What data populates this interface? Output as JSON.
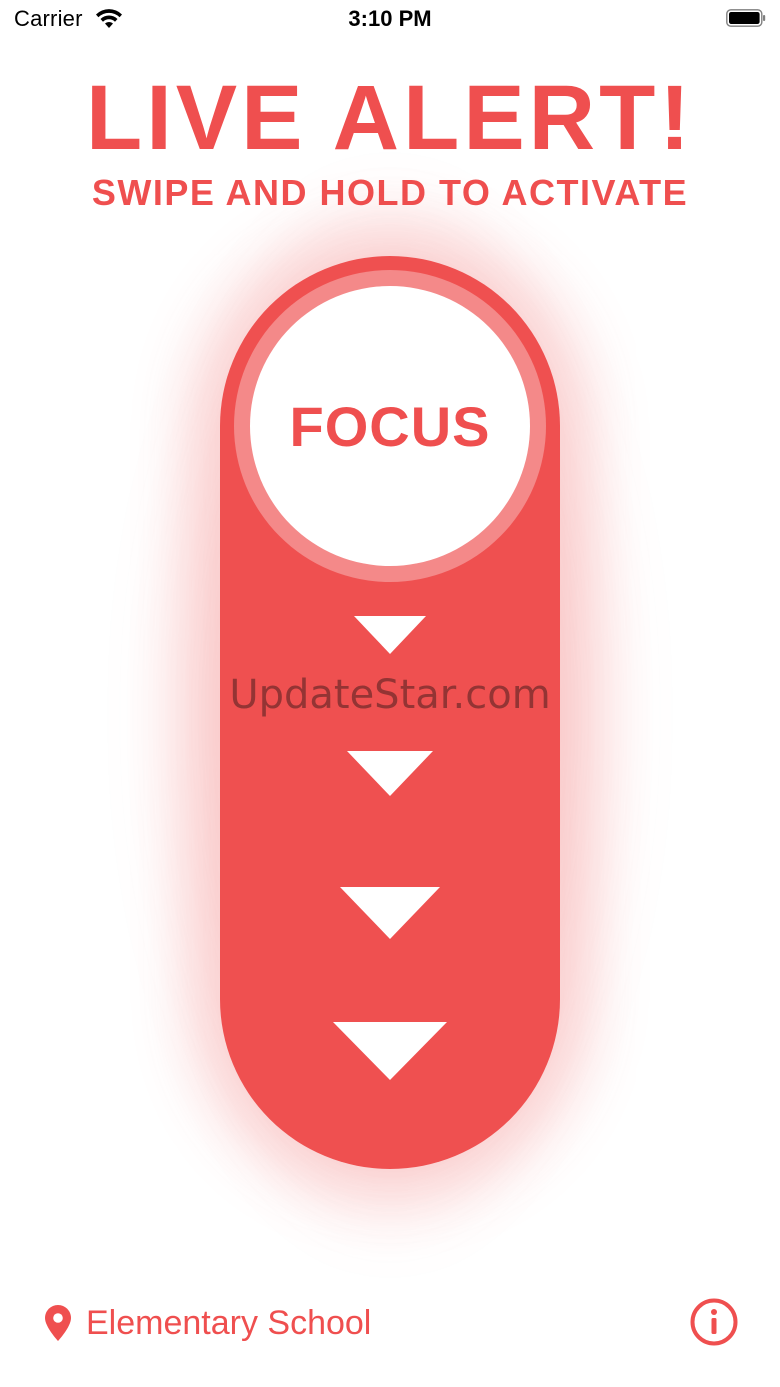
{
  "status_bar": {
    "carrier": "Carrier",
    "time": "3:10 PM",
    "icons": [
      "wifi-icon",
      "battery-icon"
    ]
  },
  "header": {
    "title": "LIVE ALERT!",
    "subtitle": "SWIPE AND HOLD TO ACTIVATE"
  },
  "slider": {
    "knob_label": "FOCUS",
    "arrow_icon": "triangle-down-icon",
    "arrow_count": 4
  },
  "watermark": "UpdateStar.com",
  "footer": {
    "location_icon": "map-pin-icon",
    "location_name": "Elementary School",
    "info_icon": "info-icon"
  },
  "colors": {
    "accent": "#ef4f4f",
    "knob_ring": "#f48989",
    "background": "#ffffff"
  }
}
